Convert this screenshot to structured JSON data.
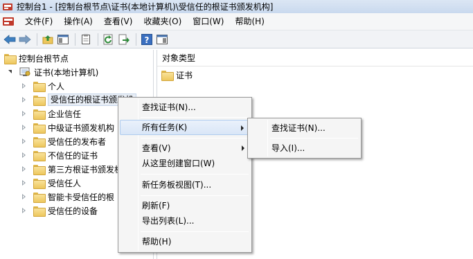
{
  "window": {
    "title": "控制台1 - [控制台根节点\\证书(本地计算机)\\受信任的根证书颁发机构]"
  },
  "menubar": {
    "items": [
      "文件(F)",
      "操作(A)",
      "查看(V)",
      "收藏夹(O)",
      "窗口(W)",
      "帮助(H)"
    ]
  },
  "tree": {
    "root": "控制台根节点",
    "computer": "证书(本地计算机)",
    "children": [
      "个人",
      "受信任的根证书颁发机构",
      "企业信任",
      "中级证书颁发机构",
      "受信任的发布者",
      "不信任的证书",
      "第三方根证书颁发机构",
      "受信任人",
      "智能卡受信任的根",
      "受信任的设备"
    ],
    "selected_truncated": "受信任的根证书颁发机",
    "truncated_7": "第三方根证书颁发机"
  },
  "right_pane": {
    "header": "对象类型",
    "items": [
      "证书"
    ]
  },
  "context_menu": {
    "find": "查找证书(N)...",
    "all_tasks": "所有任务(K)",
    "view": "查看(V)",
    "new_window": "从这里创建窗口(W)",
    "new_taskpad": "新任务板视图(T)...",
    "refresh": "刷新(F)",
    "export": "导出列表(L)...",
    "help": "帮助(H)"
  },
  "submenu": {
    "find": "查找证书(N)...",
    "import": "导入(I)..."
  },
  "colors": {
    "highlight": "#d9e6f7",
    "folder": "#edc75d",
    "title_bar": "#c9d9ee"
  }
}
